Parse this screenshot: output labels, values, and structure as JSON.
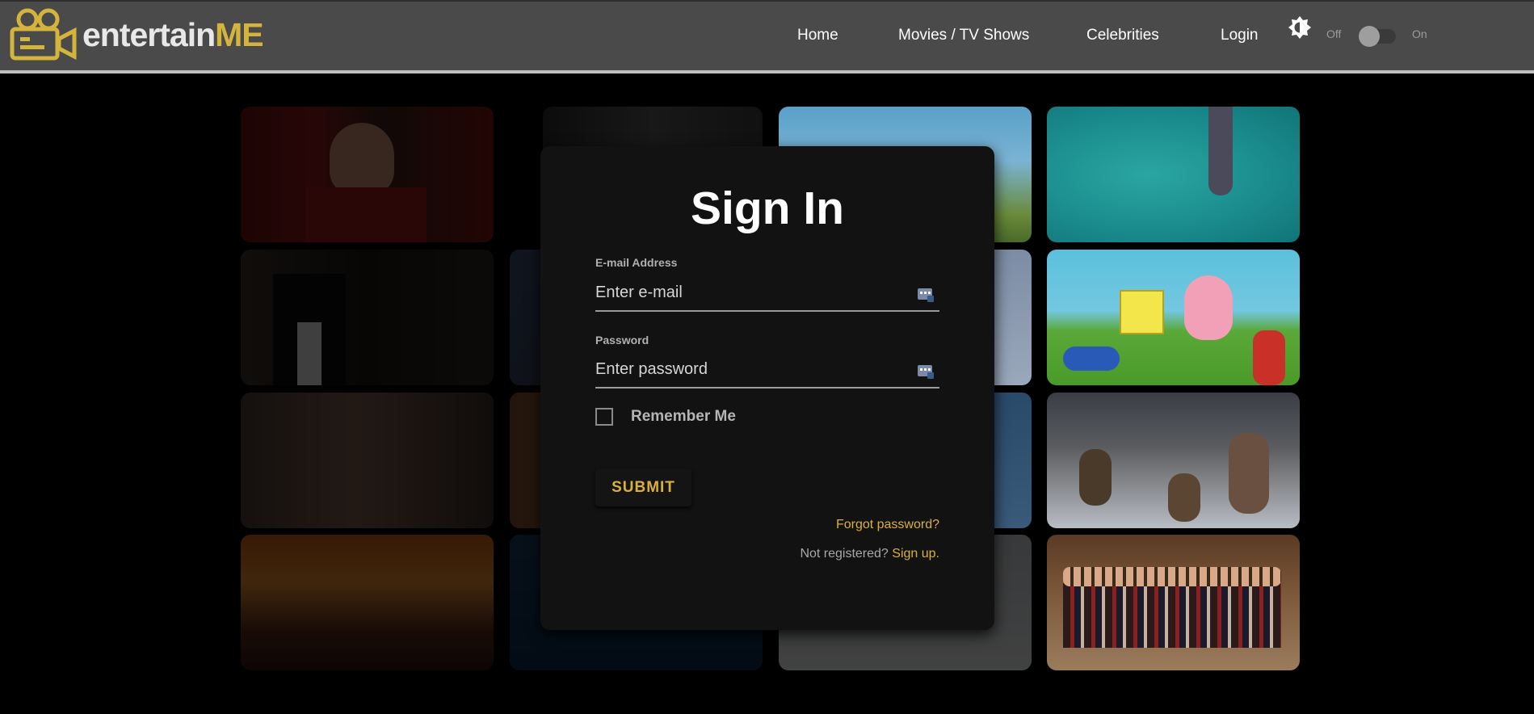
{
  "header": {
    "logo_text_a": "entertain",
    "logo_text_b": "ME",
    "nav": [
      "Home",
      "Movies / TV Shows",
      "Celebrities",
      "Login"
    ],
    "theme_icon": "brightness-icon",
    "toggle_off_label": "Off",
    "toggle_on_label": "On",
    "dark_mode_on": false
  },
  "colors": {
    "navbar": "#4a4a4a",
    "accent": "#d9b03c",
    "card": "#121212",
    "page": "#000000"
  },
  "signin": {
    "title": "Sign In",
    "email_label": "E-mail Address",
    "email_placeholder": "Enter e-mail",
    "email_value": "",
    "password_label": "Password",
    "password_placeholder": "Enter password",
    "password_value": "",
    "remember_label": "Remember Me",
    "remember_checked": false,
    "submit_label": "SUBMIT",
    "forgot_label": "Forgot password?",
    "not_registered_text": "Not registered?",
    "signup_label": "Sign up."
  },
  "background_tiles": [
    "rebel-in-red-jacket",
    "man-in-suit-bw",
    "hiker-landscape",
    "diver-in-pool",
    "godfather-tuxedo",
    "dark-rocks",
    "blue-gray-scene",
    "spongebob-patrick",
    "couple-embrace",
    "rusty-statue",
    "ocean-scene",
    "jungle-adventurers",
    "sunset-bicycles",
    "dark-water",
    "snowy-scene",
    "bachelor-group"
  ]
}
